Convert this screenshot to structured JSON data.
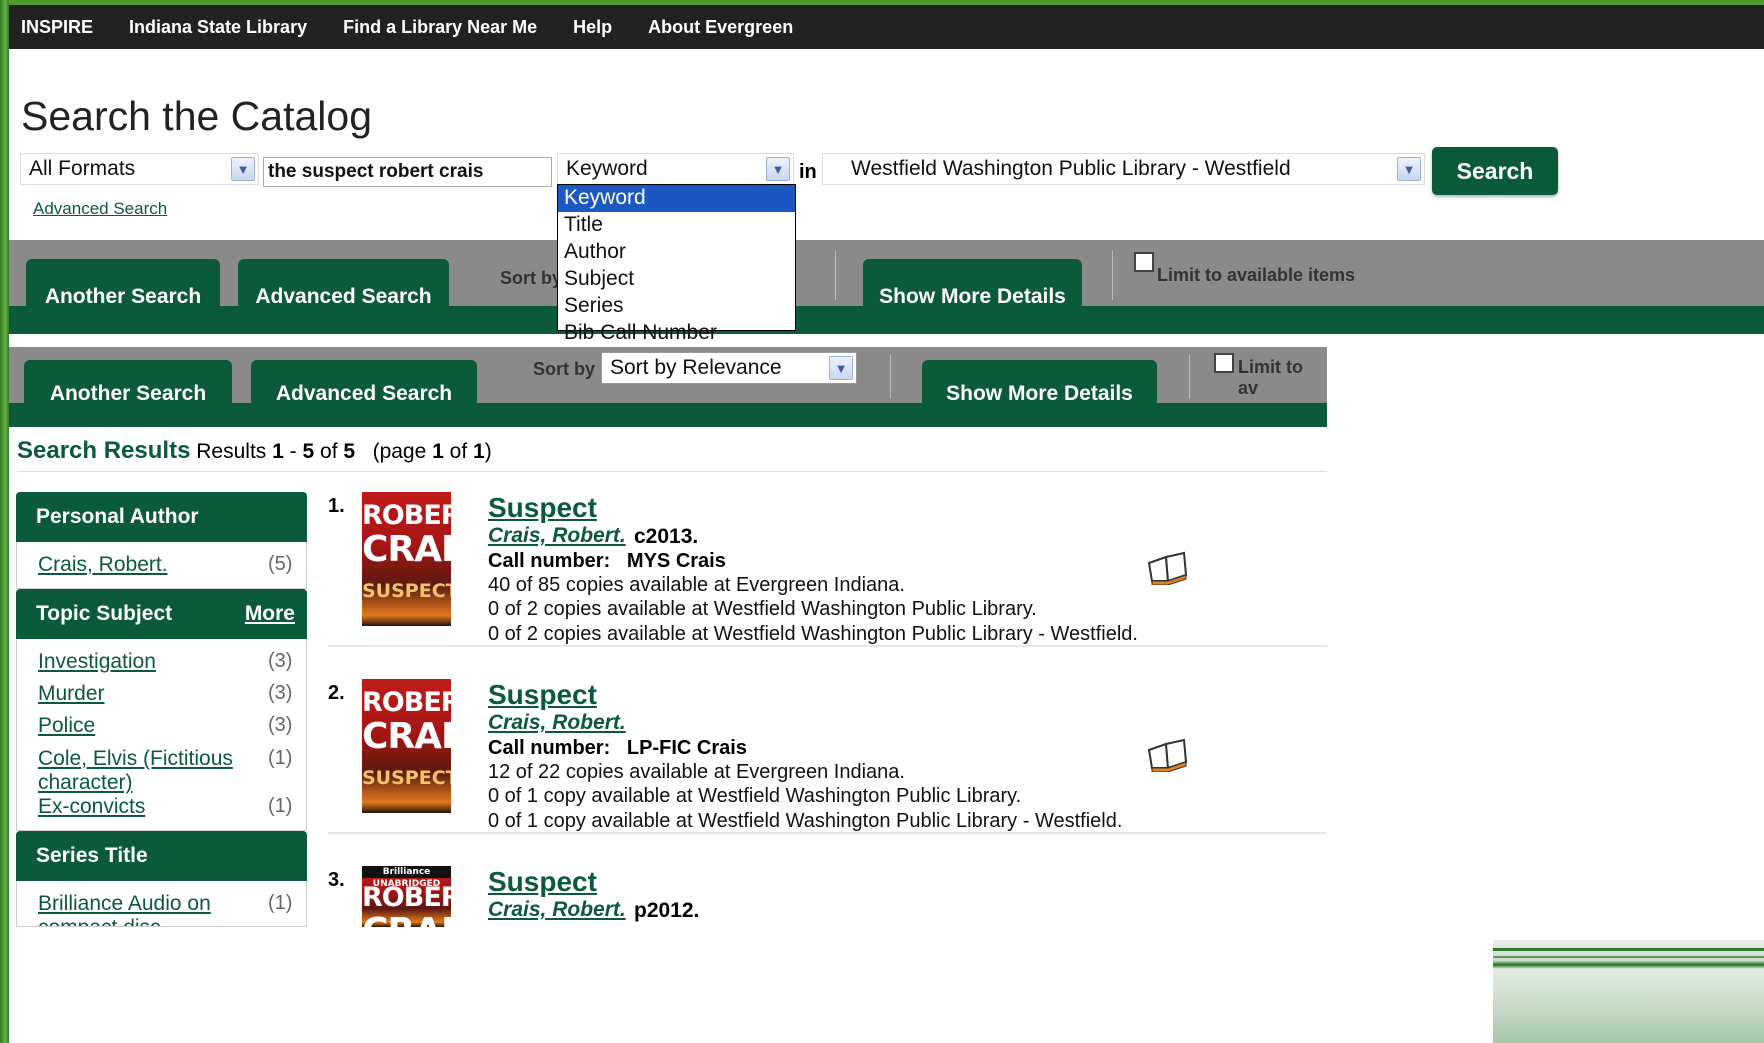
{
  "topnav": {
    "items": [
      "INSPIRE",
      "Indiana State Library",
      "Find a Library Near Me",
      "Help",
      "About Evergreen"
    ]
  },
  "page_title": "Search the Catalog",
  "search": {
    "format": "All Formats",
    "query": "the suspect robert crais",
    "type": "Keyword",
    "in_label": "in",
    "library": "Westfield Washington Public Library - Westfield",
    "button": "Search",
    "advanced_link": "Advanced Search",
    "type_options": [
      "Keyword",
      "Title",
      "Author",
      "Subject",
      "Series",
      "Bib Call Number"
    ]
  },
  "toolbar": {
    "another_search": "Another Search",
    "advanced_search": "Advanced Search",
    "sort_label": "Sort by",
    "sort_value": "Sort by Relevance",
    "show_more": "Show More Details",
    "limit_label": "Limit to available items",
    "limit_label_cut": "Limit to av"
  },
  "results_header": {
    "label": "Search Results",
    "range_prefix": "Results",
    "range_start": "1",
    "range_end": "5",
    "total": "5",
    "page_prefix": "(page",
    "page": "1",
    "page_total": "1"
  },
  "facets": {
    "author": {
      "title": "Personal Author",
      "items": [
        {
          "label": "Crais, Robert.",
          "count": "(5)"
        }
      ]
    },
    "topic": {
      "title": "Topic Subject",
      "more": "More",
      "items": [
        {
          "label": "Investigation",
          "count": "(3)"
        },
        {
          "label": "Murder",
          "count": "(3)"
        },
        {
          "label": "Police",
          "count": "(3)"
        },
        {
          "label": "Cole, Elvis (Fictitious",
          "label2": "character)",
          "count": "(1)"
        },
        {
          "label": "Ex-convicts",
          "count": "(1)"
        }
      ]
    },
    "series": {
      "title": "Series Title",
      "items": [
        {
          "label": "Brilliance Audio on",
          "label2": "compact disc",
          "count": "(1)"
        }
      ]
    }
  },
  "results": [
    {
      "num": "1.",
      "cover": {
        "l1": "ROBERT",
        "l2": "CRAIS",
        "l3": "SUSPECT"
      },
      "title": "Suspect",
      "author": "Crais, Robert.",
      "date": "c2013.",
      "call_label": "Call number:",
      "call_number": "MYS Crais",
      "lines": [
        "40 of 85 copies available at Evergreen Indiana.",
        "0 of 2 copies available at Westfield Washington Public Library.",
        "0 of 2 copies available at Westfield Washington Public Library - Westfield."
      ]
    },
    {
      "num": "2.",
      "cover": {
        "l1": "ROBERT",
        "l2": "CRAIS",
        "l3": "SUSPECT"
      },
      "title": "Suspect",
      "author": "Crais, Robert.",
      "date": "",
      "call_label": "Call number:",
      "call_number": "LP-FIC Crais",
      "lines": [
        "12 of 22 copies available at Evergreen Indiana.",
        "0 of 1 copy available at Westfield Washington Public Library.",
        "0 of 1 copy available at Westfield Washington Public Library - Westfield."
      ]
    },
    {
      "num": "3.",
      "cover": {
        "banner": "Brilliance UNABRIDGED",
        "l1": "ROBERT",
        "l2": "CRAIS"
      },
      "title": "Suspect",
      "author": "Crais, Robert.",
      "date": "p2012."
    }
  ]
}
